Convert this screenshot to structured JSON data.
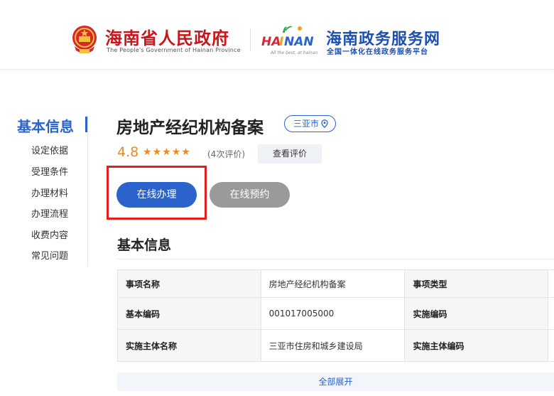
{
  "header": {
    "gov_name": "海南省人民政府",
    "gov_en": "The People's Government of Hainan Province",
    "hainan_logo_text": "HAINAN",
    "service_name": "海南政务服务网",
    "service_subtitle": "全国一体化在线政务服务平台"
  },
  "sidebar": {
    "title": "基本信息",
    "items": [
      "设定依据",
      "受理条件",
      "办理材料",
      "办理流程",
      "收费内容",
      "常见问题"
    ]
  },
  "item": {
    "title": "房地产经纪机构备案",
    "region": "三亚市",
    "rating_score": "4.8",
    "rating_stars": 5,
    "review_count": "(4次评价)",
    "view_reviews": "查看评价"
  },
  "actions": {
    "online": "在线办理",
    "reserve": "在线预约"
  },
  "basic_info": {
    "section_title": "基本信息",
    "rows": [
      [
        {
          "k": "事项名称",
          "v": "房地产经纪机构备案"
        },
        {
          "k": "事项类型",
          "v": ""
        }
      ],
      [
        {
          "k": "基本编码",
          "v": "001017005000"
        },
        {
          "k": "实施编码",
          "v": ""
        }
      ],
      [
        {
          "k": "实施主体名称",
          "v": "三亚市住房和城乡建设局"
        },
        {
          "k": "实施主体编码",
          "v": ""
        }
      ]
    ],
    "expand": "全部展开"
  },
  "colors": {
    "brand_blue": "#2a63cc",
    "gov_red": "#c8161d",
    "rating_orange": "#f08a1c",
    "highlight_red": "#e02020"
  }
}
